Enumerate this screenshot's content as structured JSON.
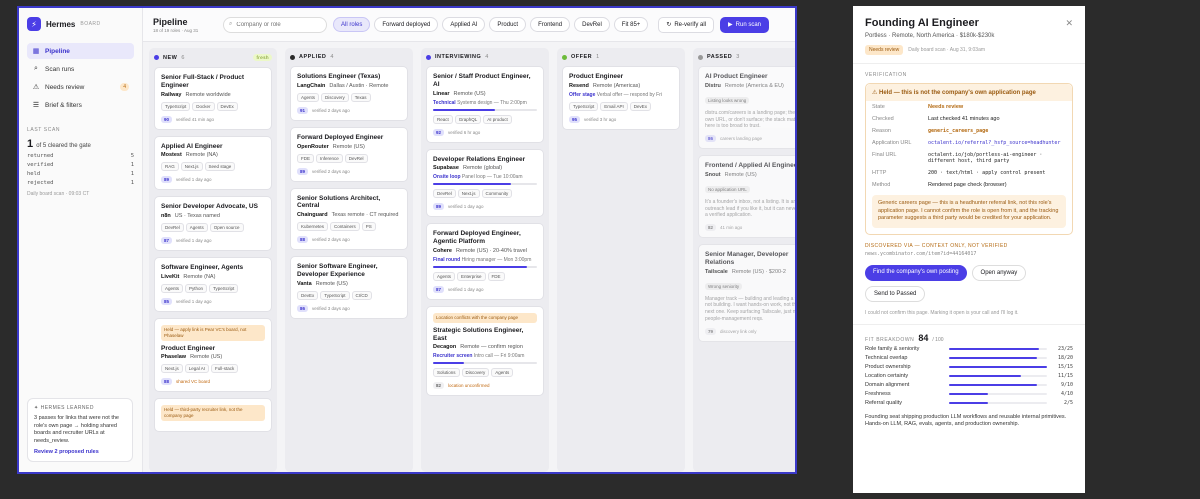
{
  "sidebar": {
    "brand": "Hermes",
    "brand_sub": "BOARD",
    "nav": [
      {
        "label": "Pipeline",
        "active": true
      },
      {
        "label": "Scan runs"
      },
      {
        "label": "Needs review",
        "badge": "4"
      },
      {
        "label": "Brief & filters"
      }
    ],
    "last_scan_heading": "LAST SCAN",
    "last_scan_big": "1",
    "last_scan_text": "of 5 cleared the gate",
    "stats": [
      {
        "label": "returned",
        "value": "5"
      },
      {
        "label": "verified",
        "value": "1"
      },
      {
        "label": "held",
        "value": "1"
      },
      {
        "label": "rejected",
        "value": "1"
      }
    ],
    "scan_footer": "Daily board scan · 09:03 CT",
    "learned": {
      "heading": "HERMES LEARNED",
      "text": "3 passes for links that were not the role's own page → holding shared boards and recruiter URLs at needs_review.",
      "link": "Review 2 proposed rules"
    }
  },
  "topbar": {
    "title": "Pipeline",
    "subtitle": "18 of 19 roles · Aug 31",
    "search_placeholder": "Company or role",
    "filters": [
      "All roles",
      "Forward deployed",
      "Applied AI",
      "Product",
      "Frontend",
      "DevRel",
      "Fit 85+"
    ],
    "reverify": "Re-verify all",
    "run_scan": "Run scan"
  },
  "columns": [
    {
      "name": "NEW",
      "count": "6",
      "fresh": "fresh",
      "color": "#4b3ee6",
      "cards": [
        {
          "title": "Senior Full-Stack / Product Engineer",
          "company": "Railway",
          "loc": "Remote worldwide",
          "tags": [
            "TypeScript",
            "Docker",
            "DevEx"
          ],
          "score": "90",
          "status": "verified 41 min ago"
        },
        {
          "title": "Applied AI Engineer",
          "company": "Mostest",
          "loc": "Remote (NA)",
          "tags": [
            "RAG",
            "Next.js",
            "Seed stage"
          ],
          "score": "89",
          "status": "verified 1 day ago"
        },
        {
          "title": "Senior Developer Advocate, US",
          "company": "n8n",
          "loc": "US · Texas named",
          "tags": [
            "DevRel",
            "Agents",
            "Open source"
          ],
          "score": "87",
          "status": "verified 1 day ago"
        },
        {
          "title": "Software Engineer, Agents",
          "company": "LiveKit",
          "loc": "Remote (NA)",
          "tags": [
            "Agents",
            "Python",
            "TypeScript"
          ],
          "score": "85",
          "status": "verified 1 day ago"
        },
        {
          "note": "Held — apply link is Pear VC's board, not Phaselaw",
          "title": "Product Engineer",
          "company": "Phaselaw",
          "loc": "Remote (US)",
          "tags": [
            "Next.js",
            "Legal AI",
            "Full-stack"
          ],
          "score": "88",
          "status": "shared VC board",
          "warn": true
        },
        {
          "note": "Held — third-party recruiter link, not the company page",
          "title": "",
          "company": "",
          "loc": "",
          "tags": [],
          "score": "",
          "status": ""
        }
      ]
    },
    {
      "name": "APPLIED",
      "count": "4",
      "color": "#2a2a2a",
      "cards": [
        {
          "title": "Solutions Engineer (Texas)",
          "company": "LangChain",
          "loc": "Dallas / Austin · Remote",
          "tags": [
            "Agents",
            "Discovery",
            "Texas"
          ],
          "score": "91",
          "status": "verified 2 days ago"
        },
        {
          "title": "Forward Deployed Engineer",
          "company": "OpenRouter",
          "loc": "Remote (US)",
          "tags": [
            "FDE",
            "Inference",
            "DevRel"
          ],
          "score": "89",
          "status": "verified 2 days ago"
        },
        {
          "title": "Senior Solutions Architect, Central",
          "company": "Chainguard",
          "loc": "Texas remote · CT required",
          "tags": [
            "Kubernetes",
            "Containers",
            "PS"
          ],
          "score": "88",
          "status": "verified 2 days ago"
        },
        {
          "title": "Senior Software Engineer, Developer Experience",
          "company": "Vanta",
          "loc": "Remote (US)",
          "tags": [
            "DevEx",
            "TypeScript",
            "CI/CD"
          ],
          "score": "86",
          "status": "verified 3 days ago"
        }
      ]
    },
    {
      "name": "INTERVIEWING",
      "count": "4",
      "color": "#4b3ee6",
      "cards": [
        {
          "title": "Senior / Staff Product Engineer, AI",
          "company": "Linear",
          "loc": "Remote (US)",
          "stage": "Technical",
          "stage_note": "Systems design — Thu 2:00pm",
          "progress": 0.6,
          "tags": [
            "React",
            "GraphQL",
            "AI product"
          ],
          "score": "92",
          "status": "verified 6 hr ago"
        },
        {
          "title": "Developer Relations Engineer",
          "company": "Supabase",
          "loc": "Remote (global)",
          "stage": "Onsite loop",
          "stage_note": "Panel loop — Tue 10:00am",
          "progress": 0.75,
          "tags": [
            "DevRel",
            "Next.js",
            "Community"
          ],
          "score": "89",
          "status": "verified 1 day ago"
        },
        {
          "title": "Forward Deployed Engineer, Agentic Platform",
          "company": "Cohere",
          "loc": "Remote (US) · 20-40% travel",
          "stage": "Final round",
          "stage_note": "Hiring manager — Mon 3:00pm",
          "progress": 0.9,
          "tags": [
            "Agents",
            "Enterprise",
            "FDE"
          ],
          "score": "87",
          "status": "verified 1 day ago"
        },
        {
          "note": "Location conflicts with the company page",
          "title": "Strategic Solutions Engineer, East",
          "company": "Decagon",
          "loc": "Remote — confirm region",
          "stage": "Recruiter screen",
          "stage_note": "Intro call — Fri 9:00am",
          "progress": 0.3,
          "tags": [
            "Solutions",
            "Discovery",
            "Agents"
          ],
          "score": "82",
          "status": "location unconfirmed",
          "warn": true
        }
      ]
    },
    {
      "name": "OFFER",
      "count": "1",
      "color": "#6dbb3b",
      "cards": [
        {
          "title": "Product Engineer",
          "company": "Resend",
          "loc": "Remote (Americas)",
          "stage": "Offer stage",
          "stage_note": "Verbal offer — respond by Fri",
          "tags": [
            "TypeScript",
            "Email API",
            "DevEx"
          ],
          "score": "95",
          "status": "verified 3 hr ago"
        }
      ]
    },
    {
      "name": "PASSED",
      "count": "3",
      "color": "#999999",
      "cards": [
        {
          "title": "AI Product Engineer",
          "company": "Distru",
          "loc": "Remote (America & EU)",
          "pill": "Listing looks wrong",
          "ghost": "distru.com/careers is a landing page; the role's own URL, or don't surface; the stack match here is too broad to trust.",
          "score": "86",
          "status": "careers landing page"
        },
        {
          "title": "Frontend / Applied AI Engineer",
          "company": "Snout",
          "loc": "Remote (US)",
          "pill": "No application URL",
          "ghost": "It's a founder's inbox, not a listing. It is an outreach lead if you like it, but it can never be a verified application.",
          "score": "82",
          "status": "41 min ago"
        },
        {
          "title": "Senior Manager, Developer Relations",
          "company": "Tailscale",
          "loc": "Remote (US) · $200-2",
          "pill": "Wrong seniority",
          "ghost": "Manager track — building and leading a team, not building. I want hands-on work, not the next one. Keep surfacing Tailscale, just not people-management reqs.",
          "score": "79",
          "status": "discovery link only"
        }
      ]
    }
  ],
  "detail": {
    "title": "Founding AI Engineer",
    "subtitle": "Portless · Remote, North America · $180k-$230k",
    "badge": "Needs review",
    "meta": "Daily board scan · Aug 31, 9:03am",
    "verification_heading": "VERIFICATION",
    "held_banner": "Held — this is not the company's own application page",
    "rows": [
      {
        "k": "State",
        "v": "Needs review",
        "cls": "warnv"
      },
      {
        "k": "Checked",
        "v": "Last checked 41 minutes ago",
        "cls": ""
      },
      {
        "k": "Reason",
        "v": "generic_careers_page",
        "cls": "mono warnv"
      },
      {
        "k": "Application URL",
        "v": "octalent.io/referral?_hsfp_source=headhunter",
        "cls": "mono link"
      },
      {
        "k": "Final URL",
        "v": "octalent.io/job/portless-ai-engineer · different host, third party",
        "cls": "mono"
      },
      {
        "k": "HTTP",
        "v": "200 · text/html · apply control present",
        "cls": "mono"
      },
      {
        "k": "Method",
        "v": "Rendered page check (browser)",
        "cls": ""
      }
    ],
    "note": "Generic careers page — this is a headhunter referral link, not this role's application page. I cannot confirm the role is open from it, and the tracking parameter suggests a third party would be credited for your application.",
    "discovered_heading": "DISCOVERED VIA — CONTEXT ONLY, NOT VERIFIED",
    "discovered_value": "news.ycombinator.com/item?id=44164017",
    "btn_find": "Find the company's own posting",
    "btn_open": "Open anyway",
    "btn_passed": "Send to Passed",
    "hint": "I could not confirm this page. Marking it open is your call and I'll log it.",
    "fit_heading": "FIT BREAKDOWN",
    "fit_score": "84",
    "fit_max": "/ 100",
    "fit_rows": [
      {
        "label": "Role family & seniority",
        "value": "23/25",
        "frac": 0.92
      },
      {
        "label": "Technical overlap",
        "value": "18/20",
        "frac": 0.9
      },
      {
        "label": "Product ownership",
        "value": "15/15",
        "frac": 1.0
      },
      {
        "label": "Location certainty",
        "value": "11/15",
        "frac": 0.73
      },
      {
        "label": "Domain alignment",
        "value": "9/10",
        "frac": 0.9
      },
      {
        "label": "Freshness",
        "value": "4/10",
        "frac": 0.4
      },
      {
        "label": "Referral quality",
        "value": "2/5",
        "frac": 0.4
      }
    ],
    "footer": "Founding seat shipping production LLM workflows and reusable internal primitives. Hands-on LLM, RAG, evals, agents, and production ownership."
  }
}
